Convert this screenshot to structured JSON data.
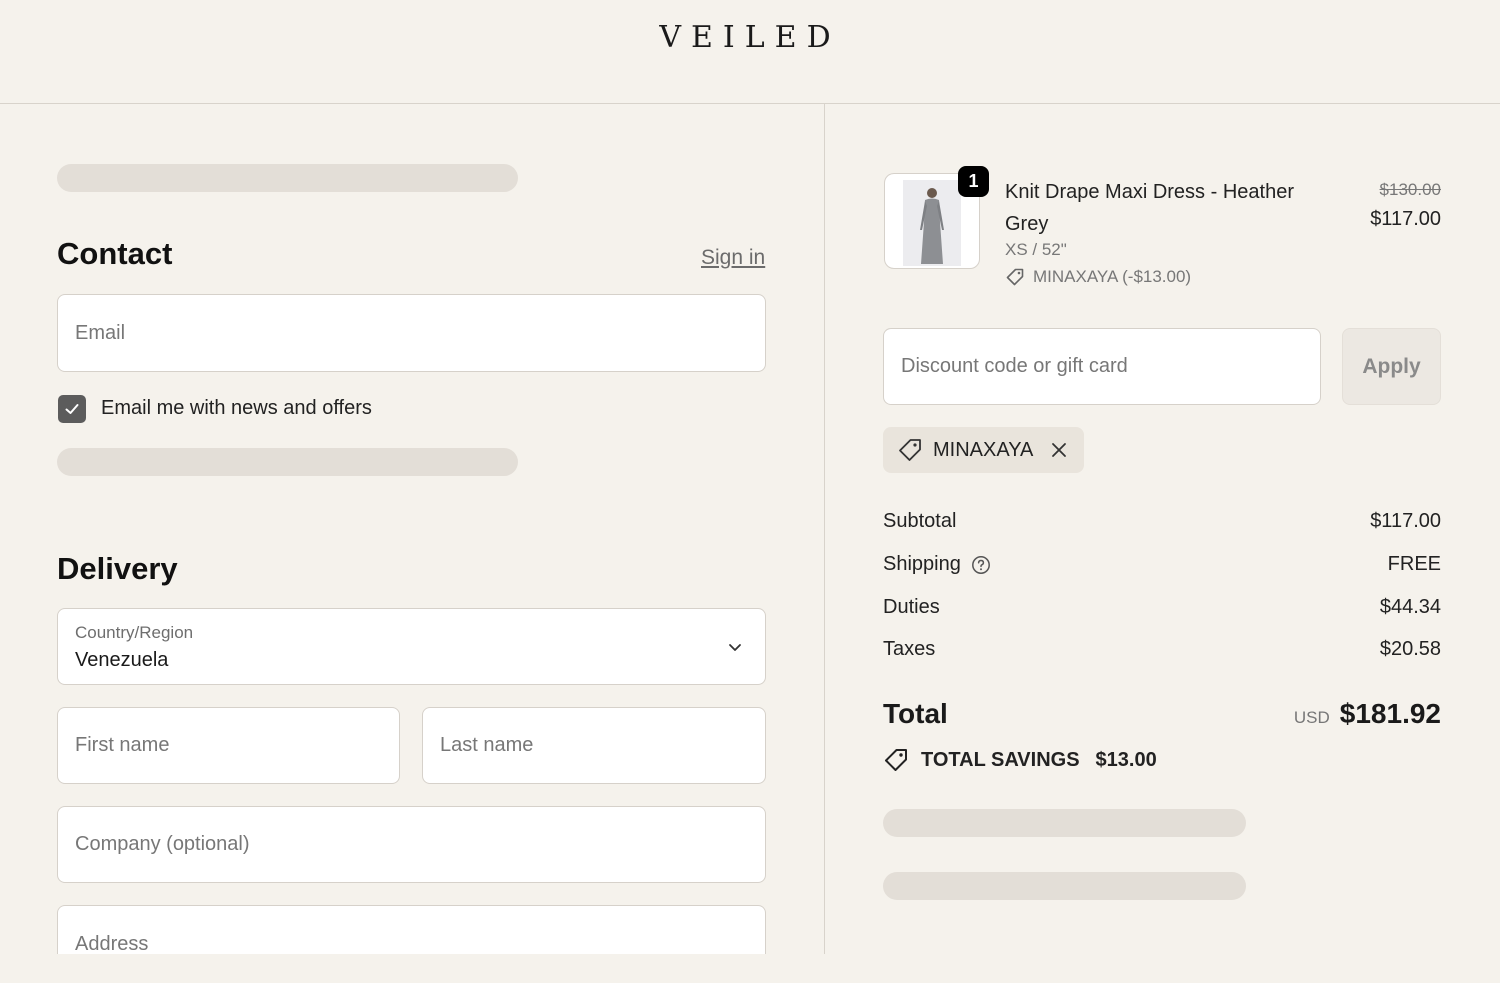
{
  "header": {
    "logo": "VEILED"
  },
  "contact": {
    "title": "Contact",
    "sign_in": "Sign in",
    "email_placeholder": "Email",
    "newsletter_label": "Email me with news and offers",
    "newsletter_checked": true
  },
  "delivery": {
    "title": "Delivery",
    "country_label": "Country/Region",
    "country_value": "Venezuela",
    "first_name_placeholder": "First name",
    "last_name_placeholder": "Last name",
    "company_placeholder": "Company (optional)",
    "address_placeholder": "Address"
  },
  "cart": {
    "item": {
      "quantity": "1",
      "name": "Knit Drape Maxi Dress - Heather Grey",
      "variant": "XS / 52\"",
      "discount": "MINAXAYA (-$13.00)",
      "price_original": "$130.00",
      "price_final": "$117.00"
    },
    "discount_placeholder": "Discount code or gift card",
    "apply_label": "Apply",
    "applied_code": "MINAXAYA"
  },
  "summary": {
    "subtotal_label": "Subtotal",
    "subtotal_value": "$117.00",
    "shipping_label": "Shipping",
    "shipping_value": "FREE",
    "duties_label": "Duties",
    "duties_value": "$44.34",
    "taxes_label": "Taxes",
    "taxes_value": "$20.58",
    "total_label": "Total",
    "currency": "USD",
    "total_value": "$181.92",
    "savings_label": "TOTAL SAVINGS",
    "savings_value": "$13.00"
  },
  "colors": {
    "background": "#f5f2ec",
    "skeleton": "#e3ded7",
    "checkbox": "#5c5c5c",
    "badge": "#000000"
  }
}
